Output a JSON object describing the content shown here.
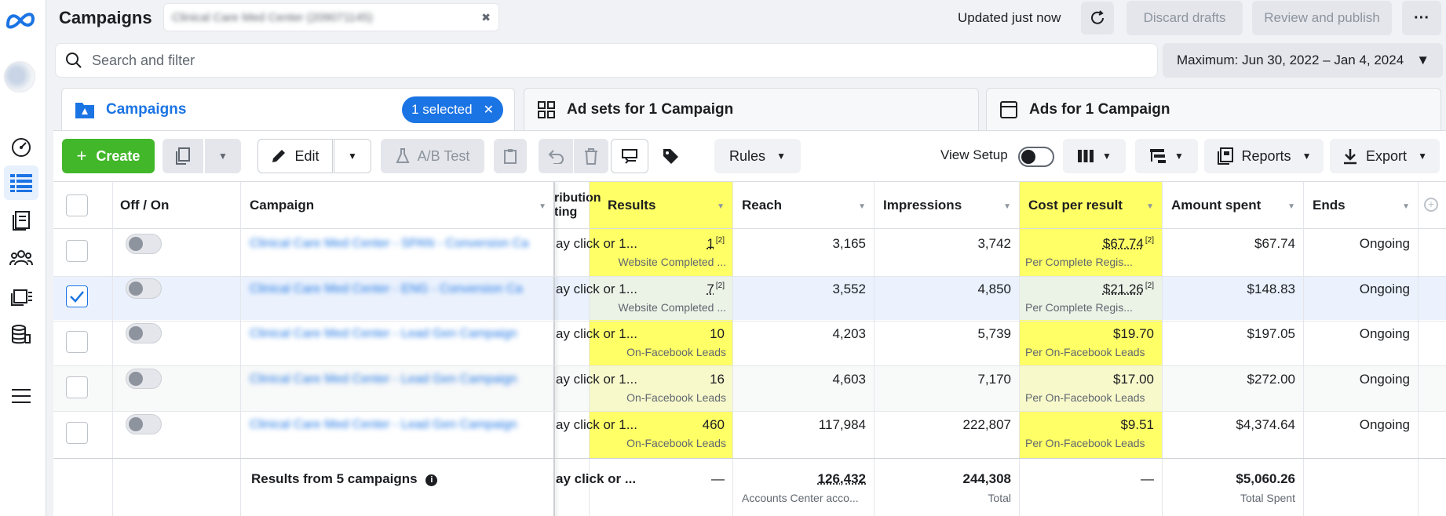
{
  "header": {
    "title": "Campaigns",
    "account_name": "Clinical Care Med Center (209071145)",
    "updated": "Updated just now",
    "discard_label": "Discard drafts",
    "review_label": "Review and publish",
    "more_label": "···"
  },
  "search": {
    "placeholder": "Search and filter",
    "date_range": "Maximum: Jun 30, 2022 – Jan 4, 2024"
  },
  "tabs": {
    "campaigns": "Campaigns",
    "selected": "1 selected",
    "adsets": "Ad sets for 1 Campaign",
    "ads": "Ads for 1 Campaign"
  },
  "toolbar": {
    "create": "Create",
    "edit": "Edit",
    "ab_test": "A/B Test",
    "rules": "Rules",
    "view_setup": "View Setup",
    "reports": "Reports",
    "export": "Export"
  },
  "table": {
    "headers": {
      "off_on": "Off / On",
      "campaign": "Campaign",
      "attribution": "ribution\nting",
      "results": "Results",
      "reach": "Reach",
      "impressions": "Impressions",
      "cost": "Cost per result",
      "spent": "Amount spent",
      "ends": "Ends"
    },
    "rows": [
      {
        "name": "Clinical Care Med Center - SPAN - Conversion Ca",
        "attribution": "ay click or 1...",
        "results": "1",
        "results_sup": "[2]",
        "results_sub": "Website Completed ...",
        "reach": "3,165",
        "impressions": "3,742",
        "cost": "$67.74",
        "cost_sup": "[2]",
        "cost_sub": "Per Complete Regis...",
        "spent": "$67.74",
        "ends": "Ongoing",
        "checked": false
      },
      {
        "name": "Clinical Care Med Center - ENG - Conversion Ca",
        "attribution": "ay click or 1...",
        "results": "7",
        "results_sup": "[2]",
        "results_sub": "Website Completed ...",
        "reach": "3,552",
        "impressions": "4,850",
        "cost": "$21.26",
        "cost_sup": "[2]",
        "cost_sub": "Per Complete Regis...",
        "spent": "$148.83",
        "ends": "Ongoing",
        "checked": true
      },
      {
        "name": "Clinical Care Med Center - Lead Gen Campaign",
        "attribution": "ay click or 1...",
        "results": "10",
        "results_sup": "",
        "results_sub": "On-Facebook Leads",
        "reach": "4,203",
        "impressions": "5,739",
        "cost": "$19.70",
        "cost_sup": "",
        "cost_sub": "Per On-Facebook Leads",
        "spent": "$197.05",
        "ends": "Ongoing",
        "checked": false
      },
      {
        "name": "Clinical Care Med Center - Lead Gen Campaign",
        "attribution": "ay click or 1...",
        "results": "16",
        "results_sup": "",
        "results_sub": "On-Facebook Leads",
        "reach": "4,603",
        "impressions": "7,170",
        "cost": "$17.00",
        "cost_sup": "",
        "cost_sub": "Per On-Facebook Leads",
        "spent": "$272.00",
        "ends": "Ongoing",
        "checked": false
      },
      {
        "name": "Clinical Care Med Center - Lead Gen Campaign",
        "attribution": "ay click or 1...",
        "results": "460",
        "results_sup": "",
        "results_sub": "On-Facebook Leads",
        "reach": "117,984",
        "impressions": "222,807",
        "cost": "$9.51",
        "cost_sup": "",
        "cost_sub": "Per On-Facebook Leads",
        "spent": "$4,374.64",
        "ends": "Ongoing",
        "checked": false
      }
    ],
    "totals": {
      "label": "Results from 5 campaigns",
      "attribution": "ay click or ...",
      "results": "—",
      "reach": "126,432",
      "reach_sub": "Accounts Center acco...",
      "impressions": "244,308",
      "impressions_sub": "Total",
      "cost": "—",
      "spent": "$5,060.26",
      "spent_sub": "Total Spent"
    }
  },
  "colors": {
    "highlight": "#ffff66",
    "accent": "#1b74e4",
    "create": "#42b72a"
  }
}
